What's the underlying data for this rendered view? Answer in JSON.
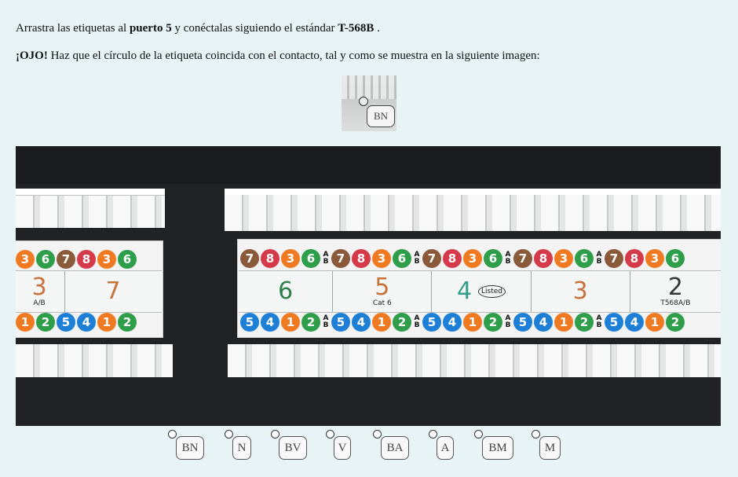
{
  "instructions": {
    "line1_pre": "Arrastra las etiquetas al ",
    "line1_bold": "puerto 5",
    "line1_mid": " y conéctalas siguiendo el estándar ",
    "line1_bold2": "T-568B",
    "line1_post": " .",
    "line2_bold": "¡OJO!",
    "line2_text": " Haz que el círculo de la etiqueta coincida con el contacto, tal y como se muestra en la siguiente imagen:"
  },
  "example_tag": "BN",
  "panel": {
    "ports_left": [
      "3",
      "7"
    ],
    "ports_main": [
      "6",
      "5",
      "4",
      "3",
      "2"
    ],
    "port5_caption": "Cat 6",
    "port2_caption": "T568A/B",
    "left_caption": "A/B",
    "cert_small": "Listed"
  },
  "pins_top_left": [
    "3",
    "6",
    "7",
    "8",
    "3",
    "6"
  ],
  "pins_top_main": [
    "7",
    "8",
    "3",
    "6",
    "7",
    "8",
    "3",
    "6",
    "7",
    "8",
    "3",
    "6",
    "7",
    "8",
    "3",
    "6",
    "7",
    "8",
    "3",
    "6"
  ],
  "pins_bottom_left": [
    "1",
    "2",
    "5",
    "4",
    "1",
    "2"
  ],
  "pins_bottom_main": [
    "5",
    "4",
    "1",
    "2",
    "5",
    "4",
    "1",
    "2",
    "5",
    "4",
    "1",
    "2",
    "5",
    "4",
    "1",
    "2",
    "5",
    "4",
    "1",
    "2"
  ],
  "colors": {
    "c1": "#e8c35a",
    "c2": "#2f9e4a",
    "c3": "#2f9e4a",
    "c4": "#1e7fd6",
    "c5": "#1e7fd6",
    "c6": "#2f9e4a",
    "c7": "#8a5a3a",
    "c8": "#d53a4a",
    "orange": "#f07a22",
    "green": "#2f9e4a",
    "blue": "#1e7fd6",
    "brown": "#8a5a3a",
    "red": "#d53a4a"
  },
  "tags": [
    {
      "label": "BN"
    },
    {
      "label": "N"
    },
    {
      "label": "BV"
    },
    {
      "label": "V"
    },
    {
      "label": "BA"
    },
    {
      "label": "A"
    },
    {
      "label": "BM"
    },
    {
      "label": "M"
    }
  ]
}
